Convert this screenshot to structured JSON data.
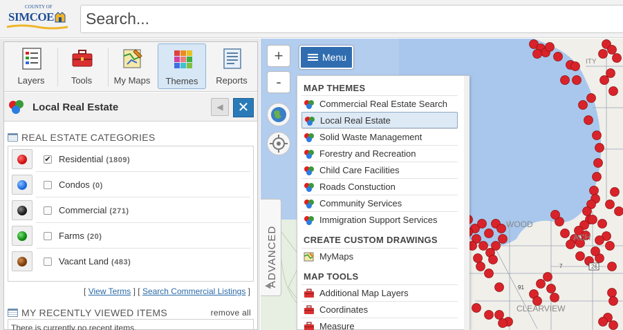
{
  "header": {
    "logo_top": "COUNTY OF",
    "logo_main": "SIMCOE",
    "search_placeholder": "Search..."
  },
  "toolbar": [
    {
      "label": "Layers",
      "icon": "layers-icon"
    },
    {
      "label": "Tools",
      "icon": "toolbox-icon"
    },
    {
      "label": "My Maps",
      "icon": "mymaps-icon"
    },
    {
      "label": "Themes",
      "icon": "themes-icon",
      "active": true
    },
    {
      "label": "Reports",
      "icon": "reports-icon"
    }
  ],
  "theme": {
    "title": "Local Real Estate",
    "back_icon": "triangle-left-icon",
    "close_icon": "close-icon"
  },
  "categories": {
    "heading": "REAL ESTATE CATEGORIES",
    "items": [
      {
        "label": "Residential",
        "count": "(1809)",
        "color": "#e02020",
        "checked": true
      },
      {
        "label": "Condos",
        "count": "(0)",
        "color": "#2b7de0",
        "checked": false
      },
      {
        "label": "Commercial",
        "count": "(271)",
        "color": "#333333",
        "checked": false
      },
      {
        "label": "Farms",
        "count": "(20)",
        "color": "#1a9a1a",
        "checked": false
      },
      {
        "label": "Vacant Land",
        "count": "(483)",
        "color": "#8a4a12",
        "checked": false
      }
    ],
    "view_terms": "View Terms",
    "search_commercial": "Search Commercial Listings"
  },
  "recent": {
    "heading": "MY RECENTLY VIEWED ITEMS",
    "remove_all": "remove all",
    "empty_text": "There is currently no recent items."
  },
  "map": {
    "zoom_in": "+",
    "zoom_out": "-",
    "menu_label": "Menu",
    "advanced_label": "ADVANCED",
    "place_labels": [
      "WOOD",
      "ACH",
      "CLEARVIEW",
      "ITY"
    ],
    "road_labels": [
      "26",
      "91",
      "7"
    ],
    "water_color": "#a9c7ec",
    "land_color": "#f0efea",
    "marker_color": "#d9232a"
  },
  "menu": {
    "themes_heading": "MAP THEMES",
    "themes": [
      {
        "label": "Commercial Real Estate Search"
      },
      {
        "label": "Local Real Estate",
        "selected": true
      },
      {
        "label": "Solid Waste Management"
      },
      {
        "label": "Forestry and Recreation"
      },
      {
        "label": "Child Care Facilities"
      },
      {
        "label": "Roads Constuction"
      },
      {
        "label": "Community Services"
      },
      {
        "label": "Immigration Support Services"
      }
    ],
    "drawings_heading": "CREATE CUSTOM DRAWINGS",
    "drawings": [
      {
        "label": "MyMaps"
      }
    ],
    "tools_heading": "MAP TOOLS",
    "tools": [
      {
        "label": "Additional Map Layers"
      },
      {
        "label": "Coordinates"
      },
      {
        "label": "Measure"
      }
    ]
  }
}
